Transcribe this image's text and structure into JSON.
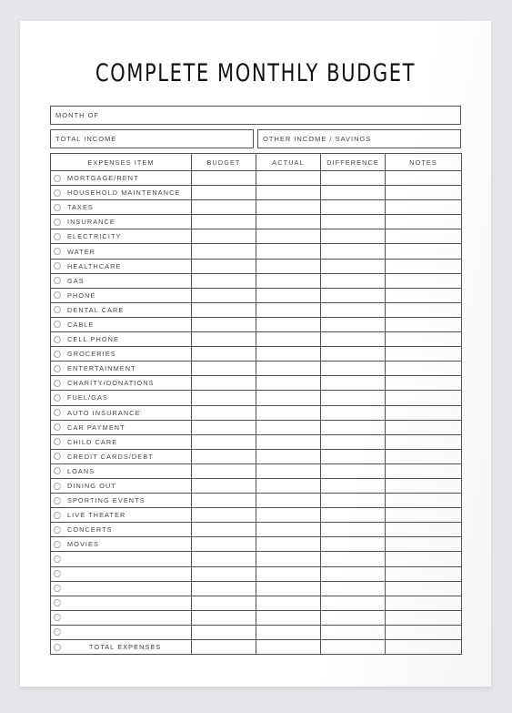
{
  "title": "COMPLETE MONTHLY BUDGET",
  "fields": {
    "month_of": "MONTH OF",
    "total_income": "TOTAL  INCOME",
    "other_income": "OTHER INCOME / SAVINGS"
  },
  "table": {
    "columns": [
      "EXPENSES ITEM",
      "BUDGET",
      "ACTUAL",
      "DIFFERENCE",
      "NOTES"
    ],
    "items": [
      "MORTGAGE/RENT",
      "HOUSEHOLD MAINTENANCE",
      "TAXES",
      "INSURANCE",
      "ELECTRICITY",
      "WATER",
      "HEALTHCARE",
      "GAS",
      "PHONE",
      "DENTAL CARE",
      "CABLE",
      "CELL PHONE",
      "GROCERIES",
      "ENTERTAINMENT",
      "CHARITY/DONATIONS",
      "FUEL/GAS",
      "AUTO INSURANCE",
      "CAR PAYMENT",
      "CHILD CARE",
      "CREDIT CARDS/DEBT",
      "LOANS",
      "DINING OUT",
      "SPORTING EVENTS",
      "LIVE THEATER",
      "CONCERTS",
      "MOVIES",
      "",
      "",
      "",
      "",
      "",
      ""
    ],
    "total_label": "TOTAL EXPENSES"
  }
}
